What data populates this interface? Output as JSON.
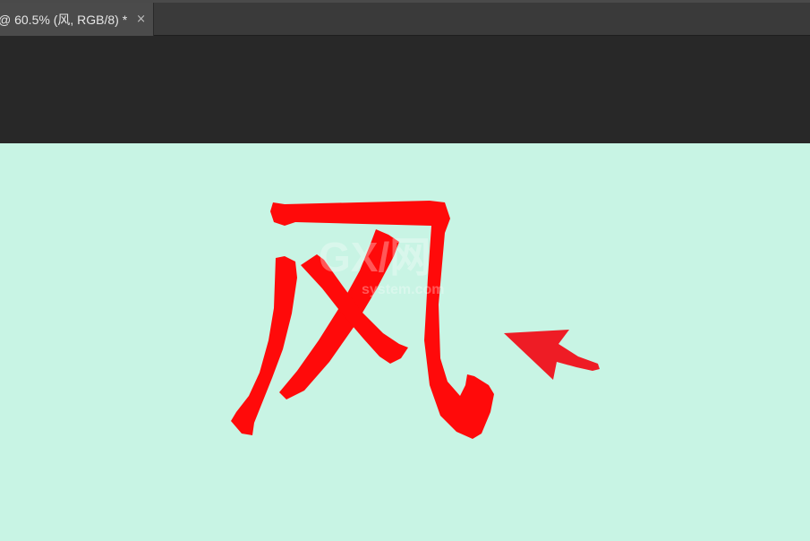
{
  "tab": {
    "title": "@ 60.5% (风, RGB/8) *",
    "close": "×"
  },
  "colors": {
    "canvas": "#c8f4e4",
    "glyph": "#ff0a0a",
    "arrow": "#ee1c25",
    "ui_dark": "#282828",
    "tab_active": "#4b4b4b"
  },
  "canvas_content": {
    "glyph": "风",
    "watermark": {
      "main": "GX/网",
      "sub": "system.com"
    },
    "arrow_icon": "arrow-pointing-left-icon"
  }
}
